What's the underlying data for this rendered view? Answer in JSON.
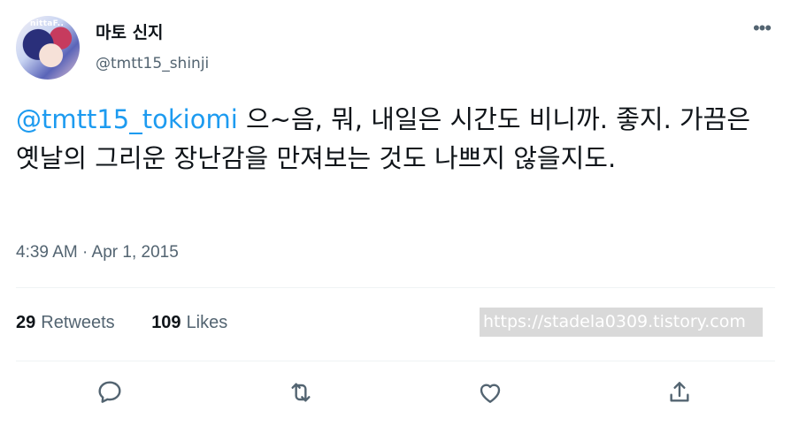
{
  "user": {
    "avatar_text": "nittaF..",
    "display_name": "마토 신지",
    "handle": "@tmtt15_shinji"
  },
  "tweet": {
    "mention": "@tmtt15_tokiomi",
    "text": " 으~음, 뭐, 내일은 시간도 비니까. 좋지. 가끔은 옛날의 그리운 장난감을 만져보는 것도 나쁘지 않을지도."
  },
  "timestamp": "4:39 AM · Apr 1, 2015",
  "stats": {
    "retweets_count": "29",
    "retweets_label": "Retweets",
    "likes_count": "109",
    "likes_label": "Likes"
  },
  "watermark": "https://stadela0309.tistory.com",
  "icons": {
    "more": "more-icon",
    "reply": "reply-icon",
    "retweet": "retweet-icon",
    "like": "like-icon",
    "share": "share-icon"
  },
  "colors": {
    "link": "#1d9bf0",
    "secondary_text": "#536471",
    "divider": "#eff3f4"
  }
}
